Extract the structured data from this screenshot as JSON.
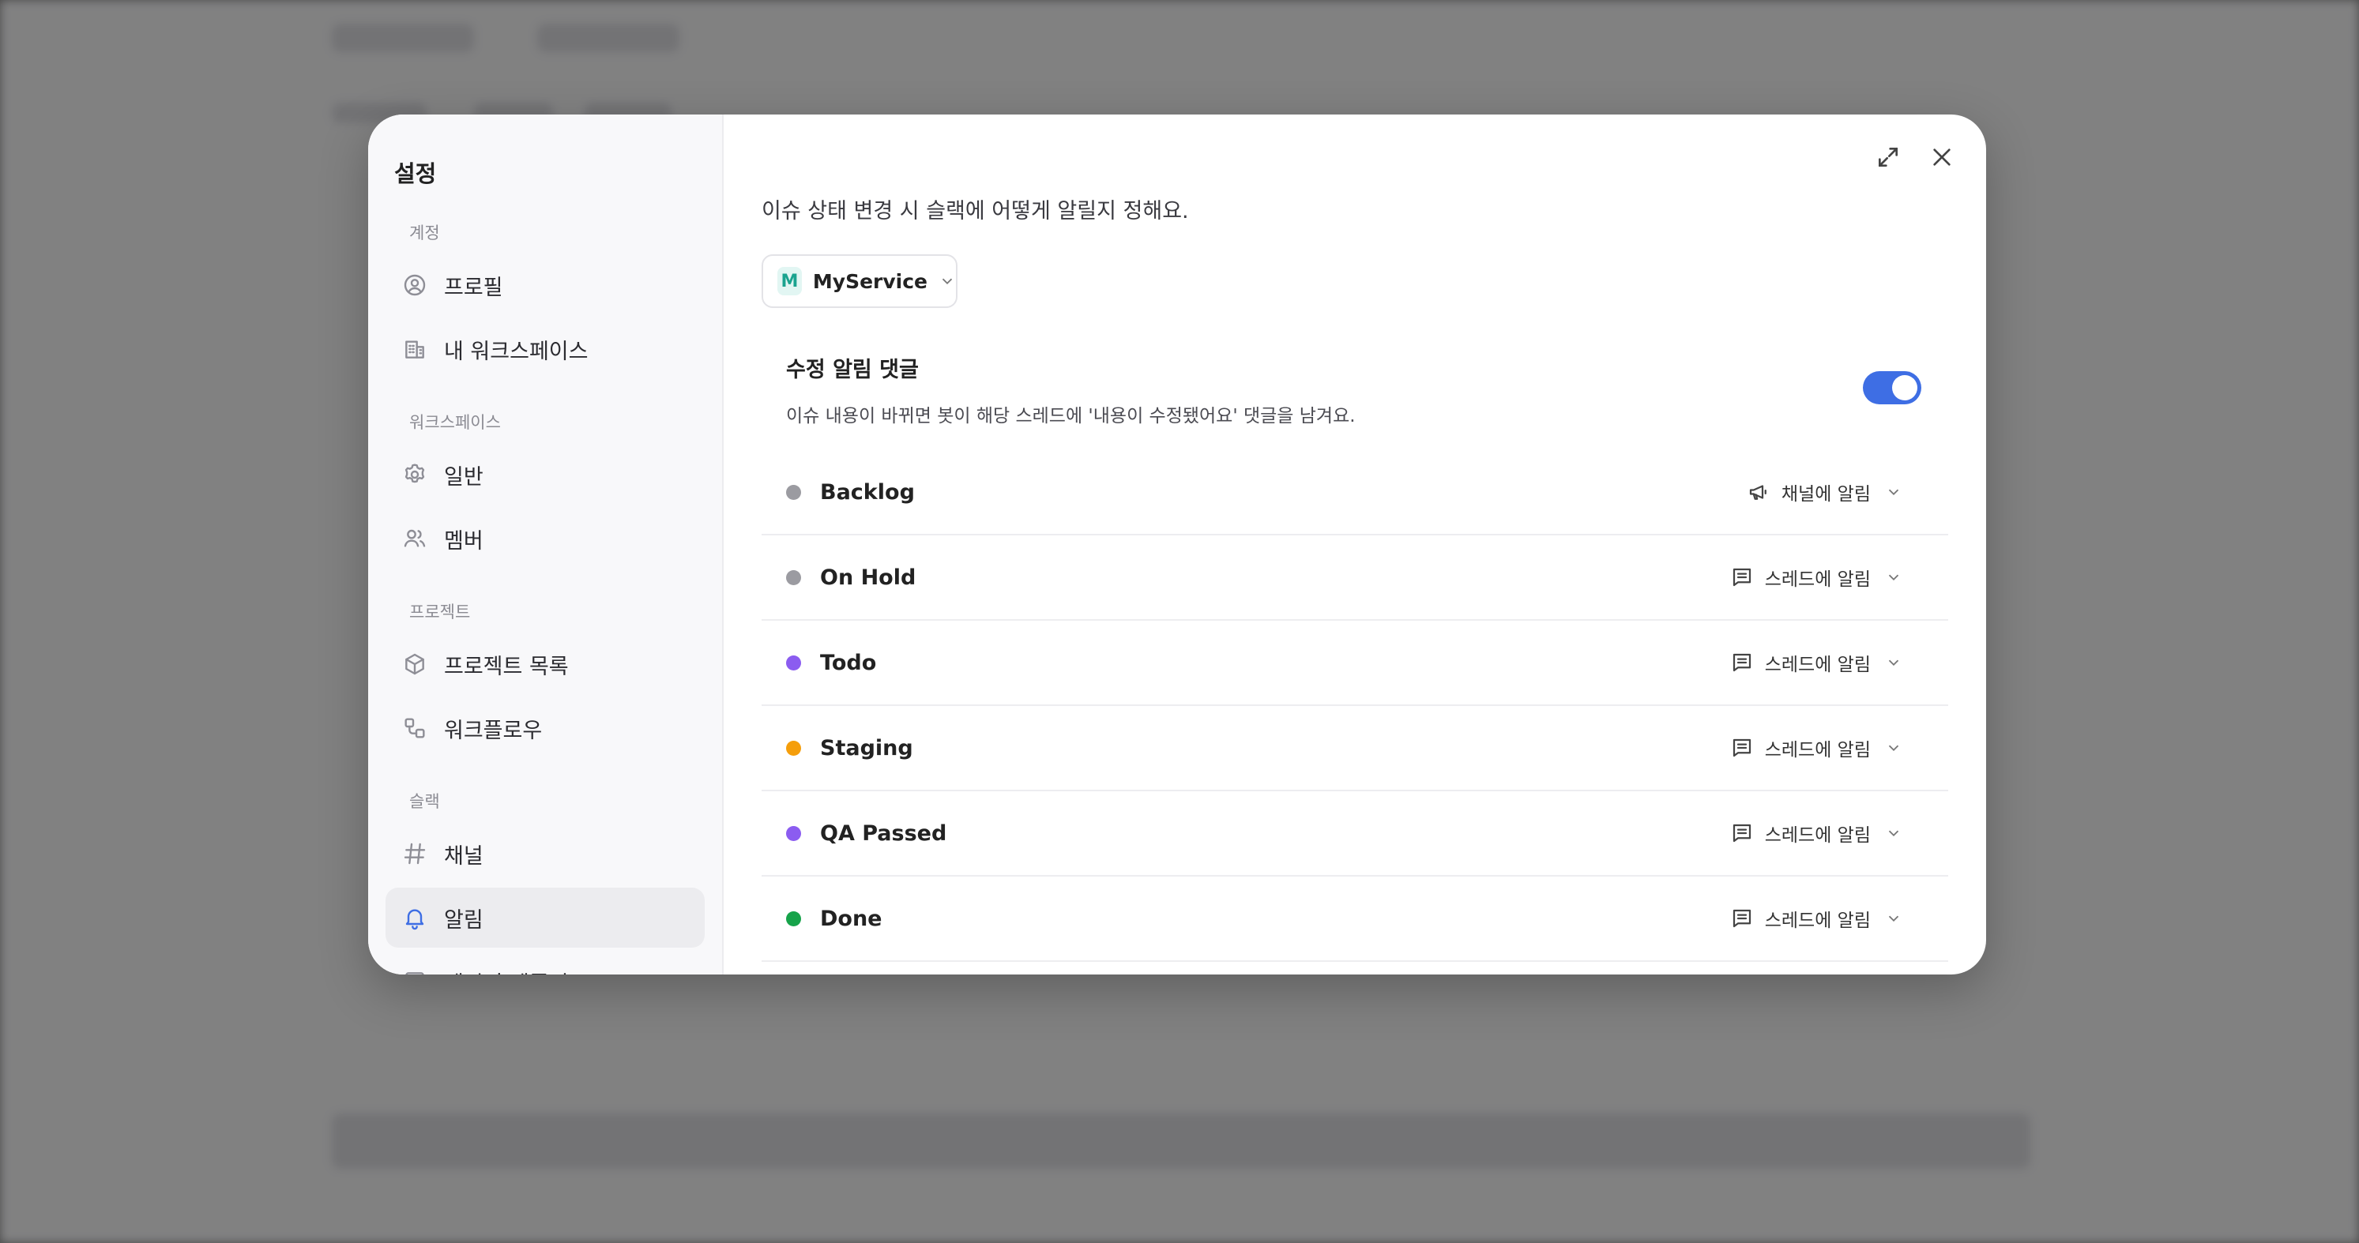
{
  "sidebar": {
    "title": "설정",
    "sections": [
      {
        "label": "계정",
        "items": [
          {
            "label": "프로필",
            "icon": "user-circle-icon"
          },
          {
            "label": "내 워크스페이스",
            "icon": "building-icon"
          }
        ]
      },
      {
        "label": "워크스페이스",
        "items": [
          {
            "label": "일반",
            "icon": "gear-icon"
          },
          {
            "label": "멤버",
            "icon": "users-icon"
          }
        ]
      },
      {
        "label": "프로젝트",
        "items": [
          {
            "label": "프로젝트 목록",
            "icon": "cube-icon"
          },
          {
            "label": "워크플로우",
            "icon": "workflow-icon"
          }
        ]
      },
      {
        "label": "슬랙",
        "items": [
          {
            "label": "채널",
            "icon": "hash-icon"
          },
          {
            "label": "알림",
            "icon": "bell-icon",
            "active": true
          },
          {
            "label": "메시지 템플릿",
            "icon": "square-icon"
          }
        ]
      }
    ]
  },
  "content": {
    "description": "이슈 상태 변경 시 슬랙에 어떻게 알릴지 정해요.",
    "service": {
      "avatar": "M",
      "name": "MyService"
    },
    "edit_comment": {
      "title": "수정 알림 댓글",
      "description": "이슈 내용이 바뀌면 봇이 해당 스레드에 '내용이 수정됐어요' 댓글을 남겨요.",
      "enabled": true
    },
    "statuses": [
      {
        "name": "Backlog",
        "color": "#9b9ba1",
        "notify": "채널에 알림",
        "notify_icon": "megaphone-icon"
      },
      {
        "name": "On Hold",
        "color": "#9b9ba1",
        "notify": "스레드에 알림",
        "notify_icon": "message-icon"
      },
      {
        "name": "Todo",
        "color": "#8b5cf0",
        "notify": "스레드에 알림",
        "notify_icon": "message-icon"
      },
      {
        "name": "Staging",
        "color": "#f59e0b",
        "notify": "스레드에 알림",
        "notify_icon": "message-icon"
      },
      {
        "name": "QA Passed",
        "color": "#8b5cf0",
        "notify": "스레드에 알림",
        "notify_icon": "message-icon"
      },
      {
        "name": "Done",
        "color": "#16a34a",
        "notify": "스레드에 알림",
        "notify_icon": "message-icon"
      }
    ]
  },
  "colors": {
    "accent": "#3e6ee4"
  }
}
